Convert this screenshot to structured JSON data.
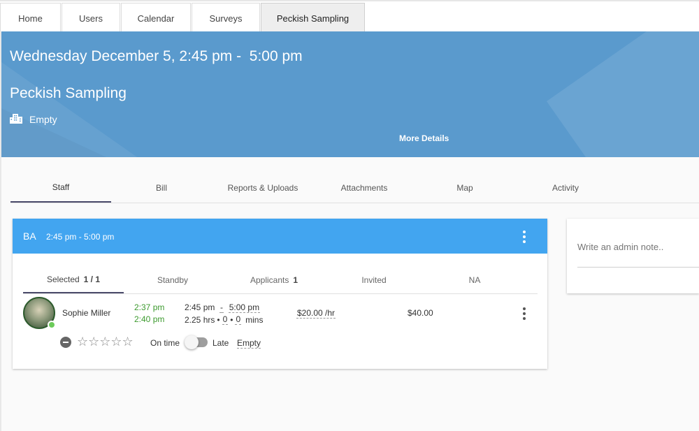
{
  "top_tabs": [
    {
      "label": "Home"
    },
    {
      "label": "Users"
    },
    {
      "label": "Calendar"
    },
    {
      "label": "Surveys"
    },
    {
      "label": "Peckish Sampling",
      "active": true
    }
  ],
  "hero": {
    "date_time": "Wednesday December 5, 2:45 pm -  5:00 pm",
    "title": "Peckish Sampling",
    "location_icon": "building-icon",
    "location": "Empty",
    "more_details": "More Details",
    "background_color": "#5a9acd"
  },
  "section_tabs": [
    {
      "label": "Staff",
      "active": true
    },
    {
      "label": "Bill"
    },
    {
      "label": "Reports & Uploads"
    },
    {
      "label": "Attachments"
    },
    {
      "label": "Map"
    },
    {
      "label": "Activity"
    }
  ],
  "shift": {
    "role": "BA",
    "time": "2:45 pm - 5:00 pm",
    "header_color": "#42a5f0",
    "menu_icon": "more-vert-icon",
    "sub_tabs": [
      {
        "label": "Selected",
        "count": "1 / 1",
        "active": true
      },
      {
        "label": "Standby",
        "count": ""
      },
      {
        "label": "Applicants",
        "count": "1"
      },
      {
        "label": "Invited",
        "count": ""
      },
      {
        "label": "NA",
        "count": ""
      }
    ],
    "staff": [
      {
        "name": "Sophie Miller",
        "status": "online",
        "clock_in": "2:37 pm",
        "clock_out": "2:40 pm",
        "start": "2:45 pm",
        "dash": "-",
        "end": "5:00 pm",
        "hours": "2.25 hrs",
        "break_a": "0",
        "break_b": "0",
        "mins_label": "mins",
        "rate": "$20.00 /hr",
        "total": "$40.00",
        "rating_stars": "☆☆☆☆☆",
        "rating_value": 0,
        "on_time_label": "On time",
        "late_label": "Late",
        "late_toggle": false,
        "note": "Empty"
      }
    ]
  },
  "admin_note": {
    "placeholder": "Write an admin note.."
  }
}
